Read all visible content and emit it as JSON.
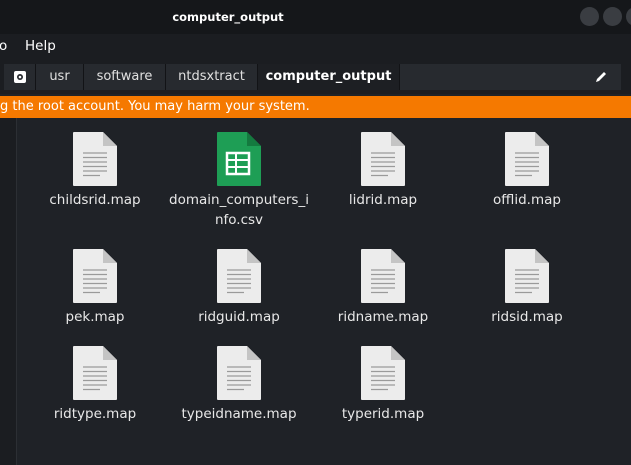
{
  "window": {
    "title": "computer_output"
  },
  "menu": {
    "items": [
      "o",
      "Help"
    ]
  },
  "path": {
    "crumbs": [
      "usr",
      "software",
      "ntdsxtract",
      "computer_output"
    ]
  },
  "banner": {
    "text": "g the root account. You may harm your system."
  },
  "files": [
    {
      "name": "childsrid.map",
      "icon": "text-file-icon"
    },
    {
      "name": "domain_computers_info.csv",
      "icon": "spreadsheet-file-icon"
    },
    {
      "name": "lidrid.map",
      "icon": "text-file-icon"
    },
    {
      "name": "offlid.map",
      "icon": "text-file-icon"
    },
    {
      "name": "pek.map",
      "icon": "text-file-icon"
    },
    {
      "name": "ridguid.map",
      "icon": "text-file-icon"
    },
    {
      "name": "ridname.map",
      "icon": "text-file-icon"
    },
    {
      "name": "ridsid.map",
      "icon": "text-file-icon"
    },
    {
      "name": "ridtype.map",
      "icon": "text-file-icon"
    },
    {
      "name": "typeidname.map",
      "icon": "text-file-icon"
    },
    {
      "name": "typerid.map",
      "icon": "text-file-icon"
    }
  ],
  "colors": {
    "accent": "#f57900",
    "spreadsheet": "#1e9e55"
  }
}
